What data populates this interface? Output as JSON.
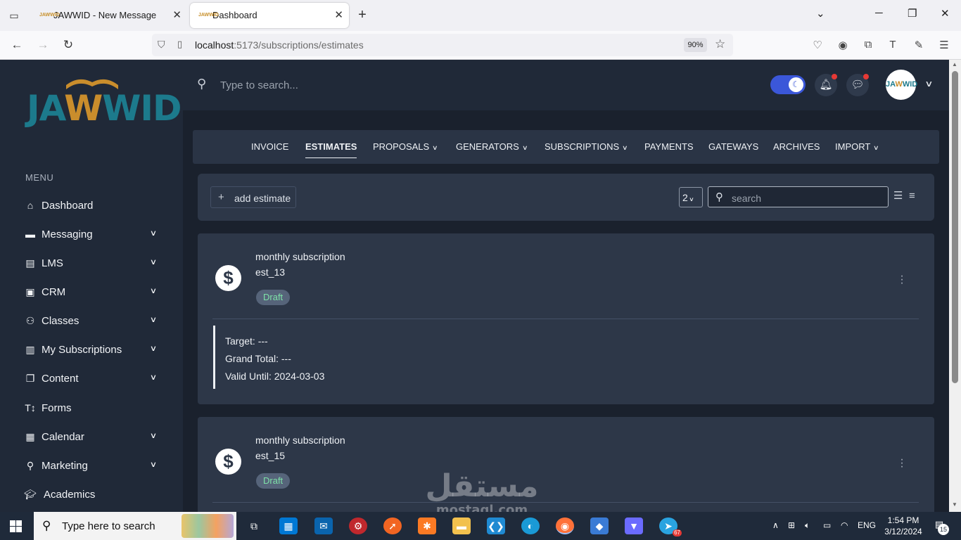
{
  "browser": {
    "tabs": [
      {
        "favicon": "JAWWID",
        "title": "JAWWID - New Message"
      },
      {
        "favicon": "JAWWID",
        "title": "Dashboard"
      }
    ],
    "url_host": "localhost",
    "url_rest": ":5173/subscriptions/estimates",
    "zoom": "90%"
  },
  "app": {
    "logo_left": "JA",
    "logo_w": "W",
    "logo_right": "WID",
    "search_placeholder": "Type to search...",
    "avatar_text_left": "JA",
    "avatar_text_w": "W",
    "avatar_text_right": "WID",
    "dark_mode": true
  },
  "sidebar": {
    "menu_title": "MENU",
    "items": [
      {
        "label": "Dashboard",
        "icon": "home-icon",
        "expandable": false
      },
      {
        "label": "Messaging",
        "icon": "message-icon",
        "expandable": true
      },
      {
        "label": "LMS",
        "icon": "book-icon",
        "expandable": true
      },
      {
        "label": "CRM",
        "icon": "id-card-icon",
        "expandable": true
      },
      {
        "label": "Classes",
        "icon": "users-icon",
        "expandable": true
      },
      {
        "label": "My Subscriptions",
        "icon": "file-icon",
        "expandable": true
      },
      {
        "label": "Content",
        "icon": "copy-icon",
        "expandable": true
      },
      {
        "label": "Forms",
        "icon": "text-height-icon",
        "expandable": false
      },
      {
        "label": "Calendar",
        "icon": "calendar-icon",
        "expandable": true
      },
      {
        "label": "Marketing",
        "icon": "search-dollar-icon",
        "expandable": true
      },
      {
        "label": "Academics",
        "icon": "graduation-cap-icon",
        "expandable": false
      }
    ]
  },
  "subnav": {
    "tabs": [
      {
        "label": "INVOICE",
        "dropdown": false,
        "active": false
      },
      {
        "label": "ESTIMATES",
        "dropdown": false,
        "active": true
      },
      {
        "label": "PROPOSALS",
        "dropdown": true,
        "active": false
      },
      {
        "label": "GENERATORS",
        "dropdown": true,
        "active": false
      },
      {
        "label": "SUBSCRIPTIONS",
        "dropdown": true,
        "active": false
      },
      {
        "label": "PAYMENTS",
        "dropdown": false,
        "active": false
      },
      {
        "label": "GATEWAYS",
        "dropdown": false,
        "active": false
      },
      {
        "label": "ARCHIVES",
        "dropdown": false,
        "active": false
      },
      {
        "label": "IMPORT",
        "dropdown": true,
        "active": false
      }
    ]
  },
  "toolbar": {
    "add_label": "add estimate",
    "per_page": "2",
    "search_placeholder": "search"
  },
  "estimates": [
    {
      "title": "monthly subscription",
      "code": "est_13",
      "status": "Draft",
      "target": "Target: ---",
      "grand_total": "Grand Total: ---",
      "valid_until": "Valid Until: 2024-03-03"
    },
    {
      "title": "monthly subscription",
      "code": "est_15",
      "status": "Draft"
    }
  ],
  "watermark": {
    "arabic": "مستقل",
    "latin": "mostaql.com"
  },
  "taskbar": {
    "search_placeholder": "Type here to search",
    "language": "ENG",
    "time": "1:54 PM",
    "date": "3/12/2024",
    "notifications": "15",
    "telegram_badge": "67"
  },
  "colors": {
    "sidebar_bg": "#202938",
    "card_bg": "#2d3748",
    "toggle_accent": "#3b57d9",
    "logo_teal": "#1c7a8c",
    "logo_gold": "#c98d2c",
    "draft_text": "#7ee2a8"
  }
}
